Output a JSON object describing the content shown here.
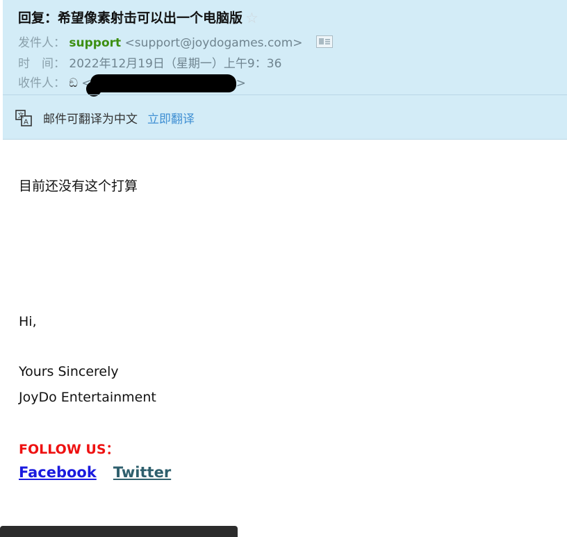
{
  "email": {
    "subject": "回复：希望像素射击可以出一个电脑版",
    "star_icon": "star-outline-icon",
    "sender": {
      "label": "发件人：",
      "name": "support",
      "address": "<support@joydogames.com>"
    },
    "time": {
      "label": "时　间：",
      "value": "2022年12月19日（星期一）上午9：36"
    },
    "recipient": {
      "label": "收件人：",
      "glyph": "ඞ",
      "open_bracket": "<",
      "close_bracket": ">"
    },
    "translate": {
      "text": "邮件可翻译为中文",
      "action": "立即翻译"
    }
  },
  "body": {
    "reply": "目前还没有这个打算",
    "greeting": "Hi,",
    "closing": "Yours Sincerely",
    "company": "JoyDo Entertainment",
    "follow": "FOLLOW US：",
    "links": {
      "facebook": "Facebook",
      "twitter": "Twitter"
    }
  },
  "colors": {
    "header_bg": "#d3ecf7",
    "sender_name": "#3d8f12",
    "translate_link": "#3f8fd3",
    "follow": "#ee1111",
    "facebook": "#1a1adf",
    "twitter": "#2e5f6d"
  }
}
